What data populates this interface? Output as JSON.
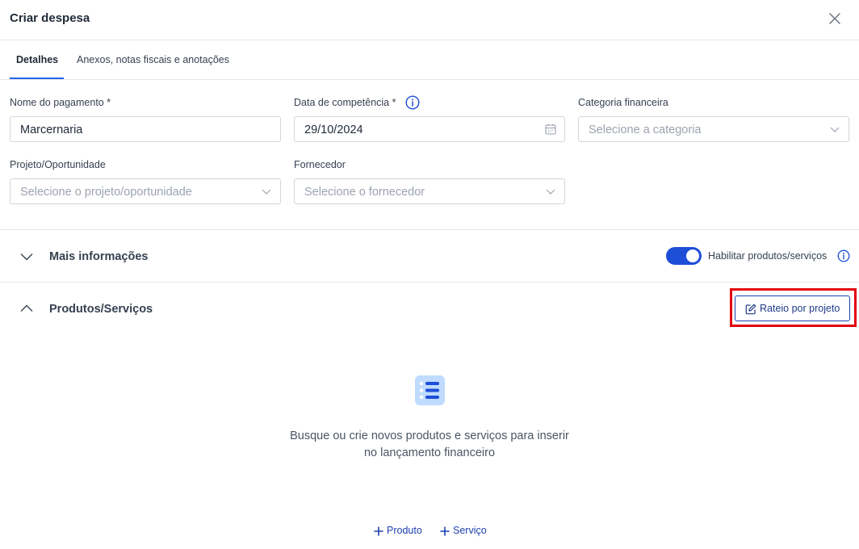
{
  "dialog": {
    "title": "Criar despesa"
  },
  "tabs": [
    {
      "label": "Detalhes",
      "active": true
    },
    {
      "label": "Anexos, notas fiscais e anotações",
      "active": false
    }
  ],
  "form": {
    "nome": {
      "label": "Nome do pagamento *",
      "value": "Marcernaria"
    },
    "data": {
      "label": "Data de competência *",
      "value": "29/10/2024"
    },
    "categoria": {
      "label": "Categoria financeira",
      "placeholder": "Selecione a categoria"
    },
    "projeto": {
      "label": "Projeto/Oportunidade",
      "placeholder": "Selecione o projeto/oportunidade"
    },
    "fornecedor": {
      "label": "Fornecedor",
      "placeholder": "Selecione o fornecedor"
    }
  },
  "mais_info": {
    "title": "Mais informações",
    "toggle_label": "Habilitar produtos/serviços",
    "toggle_on": true
  },
  "produtos": {
    "title": "Produtos/Serviços",
    "rateio_label": "Rateio por projeto",
    "empty_line1": "Busque ou crie novos produtos e serviços para inserir",
    "empty_line2": "no lançamento financeiro",
    "add_produto": "Produto",
    "add_servico": "Serviço"
  },
  "colors": {
    "accent": "#1d4ed8",
    "highlight": "#e3000f",
    "border": "#d1d5db"
  },
  "icons": [
    "close-icon",
    "info-icon",
    "calendar-icon",
    "chevron-down-icon",
    "chevron-up-icon",
    "edit-icon",
    "list-icon",
    "plus-icon"
  ]
}
